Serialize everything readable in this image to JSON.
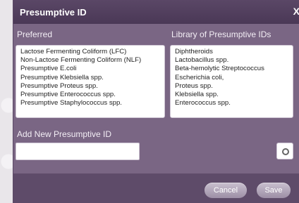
{
  "dialog": {
    "title": "Presumptive ID",
    "close_label": "X"
  },
  "preferred": {
    "label": "Preferred",
    "items": [
      "Lactose Fermenting Coliform (LFC)",
      "Non-Lactose Fermenting Coliform (NLF)",
      "Presumptive E.coli",
      "Presumptive Klebsiella spp.",
      "Presumptive Proteus spp.",
      "Presumptive Enterococcus spp.",
      "Presumptive Staphylococcus spp."
    ]
  },
  "library": {
    "label": "Library of Presumptive IDs",
    "items": [
      "Diphtheroids",
      "Lactobacillus spp.",
      "Beta-hemolytic Streptococcus",
      "Escherichia coli,",
      "Proteus spp.",
      "Klebsiella spp.",
      "Enterococcus spp."
    ]
  },
  "add_new": {
    "label": "Add New Presumptive ID",
    "value": "",
    "button_icon": "circle-add-icon"
  },
  "footer": {
    "cancel_label": "Cancel",
    "save_label": "Save"
  },
  "colors": {
    "dialog_background": "#7a6684",
    "title_bar": "#4a3856",
    "footer": "#5e4b69"
  }
}
